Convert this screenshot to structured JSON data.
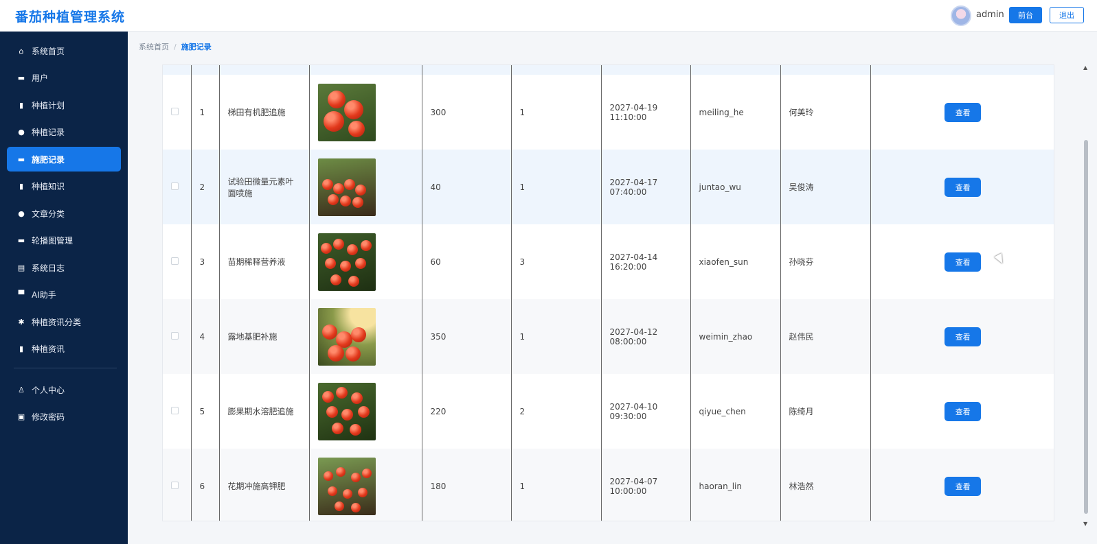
{
  "header": {
    "app_title": "番茄种植管理系统",
    "username": "admin",
    "front_label": "前台",
    "logout_label": "退出"
  },
  "sidebar": {
    "items": [
      {
        "label": "系统首页",
        "icon": "home-icon"
      },
      {
        "label": "用户",
        "icon": "briefcase-icon"
      },
      {
        "label": "种植计划",
        "icon": "bar-chart-icon"
      },
      {
        "label": "种植记录",
        "icon": "pin-icon"
      },
      {
        "label": "施肥记录",
        "icon": "briefcase-icon",
        "active": true
      },
      {
        "label": "种植知识",
        "icon": "bar-chart-icon"
      },
      {
        "label": "文章分类",
        "icon": "pin-icon"
      },
      {
        "label": "轮播图管理",
        "icon": "briefcase-icon"
      },
      {
        "label": "系统日志",
        "icon": "clipboard-icon"
      },
      {
        "label": "AI助手",
        "icon": "monitor-icon"
      },
      {
        "label": "种植资讯分类",
        "icon": "gear-icon"
      },
      {
        "label": "种植资讯",
        "icon": "bar-chart-icon"
      },
      {
        "label": "个人中心",
        "icon": "user-icon"
      },
      {
        "label": "修改密码",
        "icon": "lock-icon"
      }
    ]
  },
  "breadcrumb": {
    "home": "系统首页",
    "separator": "/",
    "current": "施肥记录"
  },
  "table": {
    "view_label": "查看",
    "rows": [
      {
        "index": "1",
        "name": "梯田有机肥追施",
        "amount": "300",
        "times": "1",
        "datetime": "2027-04-19 11:10:00",
        "account": "meiling_he",
        "person": "何美玲"
      },
      {
        "index": "2",
        "name": "试验田微量元素叶面喷施",
        "amount": "40",
        "times": "1",
        "datetime": "2027-04-17 07:40:00",
        "account": "juntao_wu",
        "person": "吴俊涛"
      },
      {
        "index": "3",
        "name": "苗期稀释营养液",
        "amount": "60",
        "times": "3",
        "datetime": "2027-04-14 16:20:00",
        "account": "xiaofen_sun",
        "person": "孙晓芬"
      },
      {
        "index": "4",
        "name": "露地基肥补施",
        "amount": "350",
        "times": "1",
        "datetime": "2027-04-12 08:00:00",
        "account": "weimin_zhao",
        "person": "赵伟民"
      },
      {
        "index": "5",
        "name": "膨果期水溶肥追施",
        "amount": "220",
        "times": "2",
        "datetime": "2027-04-10 09:30:00",
        "account": "qiyue_chen",
        "person": "陈绮月"
      },
      {
        "index": "6",
        "name": "花期冲施高钾肥",
        "amount": "180",
        "times": "1",
        "datetime": "2027-04-07 10:00:00",
        "account": "haoran_lin",
        "person": "林浩然"
      }
    ]
  },
  "colors": {
    "primary": "#1677e8",
    "sidebar_bg": "#0b2447",
    "row_highlight": "#eef5fd"
  }
}
